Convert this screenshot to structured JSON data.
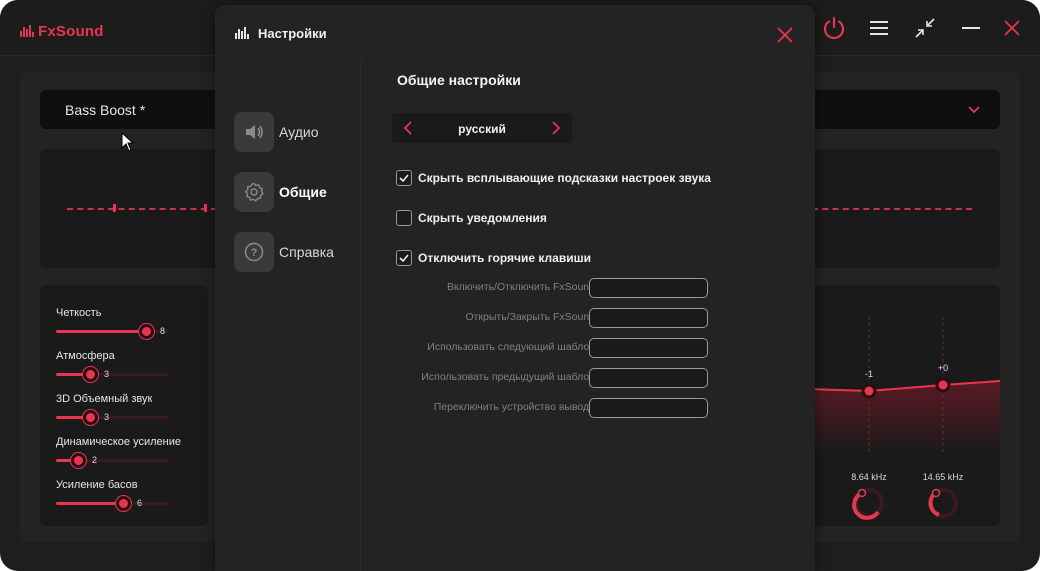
{
  "app": {
    "name": "FxSound",
    "brand_color": "#e8364f"
  },
  "icons": {
    "power": "power-icon",
    "menu": "menu-icon",
    "minimize_view": "collapse-icon",
    "minimize": "minimize-icon",
    "close": "close-icon"
  },
  "preset": {
    "name": "Bass Boost *"
  },
  "effects": [
    {
      "label": "Четкость",
      "value": "8",
      "fraction": 0.8
    },
    {
      "label": "Атмосфера",
      "value": "3",
      "fraction": 0.3
    },
    {
      "label": "3D Объемный звук",
      "value": "3",
      "fraction": 0.3
    },
    {
      "label": "Динамическое усиление",
      "value": "2",
      "fraction": 0.2
    },
    {
      "label": "Усиление басов",
      "value": "6",
      "fraction": 0.6
    }
  ],
  "eq": {
    "bands": [
      {
        "gain": "-1",
        "freq": "8.64 kHz"
      },
      {
        "gain": "+0",
        "freq": "14.65 kHz"
      }
    ]
  },
  "settings": {
    "title": "Настройки",
    "nav": [
      {
        "label": "Аудио",
        "icon": "speaker-icon",
        "active": false
      },
      {
        "label": "Общие",
        "icon": "gear-icon",
        "active": true
      },
      {
        "label": "Справка",
        "icon": "help-icon",
        "active": false
      }
    ],
    "section_title": "Общие настройки",
    "language": "русский",
    "checkboxes": [
      {
        "label": "Скрыть всплывающие подсказки настроек звука",
        "checked": true
      },
      {
        "label": "Скрыть уведомления",
        "checked": false
      },
      {
        "label": "Отключить горячие клавиши",
        "checked": true
      }
    ],
    "hotkeys": [
      {
        "label": "Включить/Отключить FxSound",
        "value": ""
      },
      {
        "label": "Открыть/Закрыть FxSound",
        "value": ""
      },
      {
        "label": "Использовать следующий шаблон",
        "value": ""
      },
      {
        "label": "Использовать предыдущий шаблон",
        "value": ""
      },
      {
        "label": "Переключить устройство вывода",
        "value": ""
      }
    ]
  }
}
